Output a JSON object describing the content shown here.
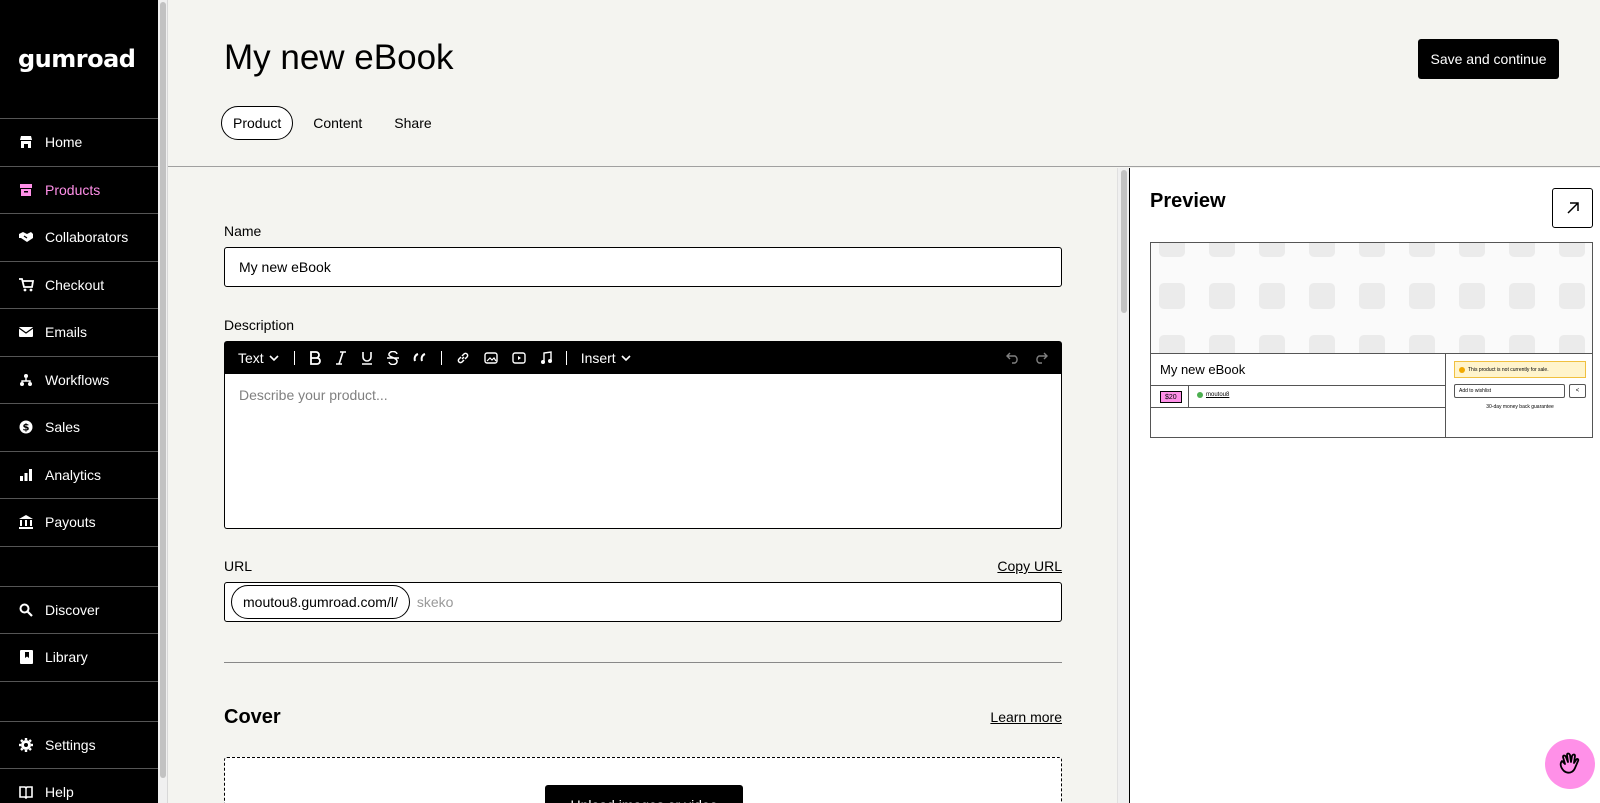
{
  "app": {
    "logo": "Gumroad"
  },
  "sidebar": {
    "items": [
      {
        "label": "Home",
        "icon": "store-icon"
      },
      {
        "label": "Products",
        "icon": "archive-icon",
        "active": true
      },
      {
        "label": "Collaborators",
        "icon": "handshake-icon"
      },
      {
        "label": "Checkout",
        "icon": "cart-icon"
      },
      {
        "label": "Emails",
        "icon": "envelope-icon"
      },
      {
        "label": "Workflows",
        "icon": "diagram-icon"
      },
      {
        "label": "Sales",
        "icon": "dollar-circle-icon"
      },
      {
        "label": "Analytics",
        "icon": "bar-chart-icon"
      },
      {
        "label": "Payouts",
        "icon": "bank-icon"
      }
    ],
    "secondary": [
      {
        "label": "Discover",
        "icon": "search-icon"
      },
      {
        "label": "Library",
        "icon": "bookmark-icon"
      }
    ],
    "footer": [
      {
        "label": "Settings",
        "icon": "gear-icon"
      },
      {
        "label": "Help",
        "icon": "book-icon"
      }
    ]
  },
  "header": {
    "title": "My new eBook",
    "save_label": "Save and continue",
    "tabs": [
      {
        "label": "Product",
        "active": true
      },
      {
        "label": "Content"
      },
      {
        "label": "Share"
      }
    ]
  },
  "form": {
    "name_label": "Name",
    "name_value": "My new eBook",
    "description_label": "Description",
    "toolbar": {
      "text_label": "Text",
      "insert_label": "Insert"
    },
    "description_placeholder": "Describe your product...",
    "url_label": "URL",
    "copy_url": "Copy URL",
    "url_prefix": "moutou8.gumroad.com/l/",
    "url_value": "skeko",
    "cover_title": "Cover",
    "learn_more": "Learn more",
    "upload_label": "Upload images or video"
  },
  "preview": {
    "title": "Preview",
    "product_title": "My new eBook",
    "price": "$20",
    "seller": "moutou8",
    "warning": "This product is not currently for sale.",
    "wishlist": "Add to wishlist",
    "guarantee": "30-day money back guarantee"
  },
  "colors": {
    "accent": "#ff90e8",
    "sidebar_bg": "#000000",
    "page_bg": "#f4f4f0"
  }
}
